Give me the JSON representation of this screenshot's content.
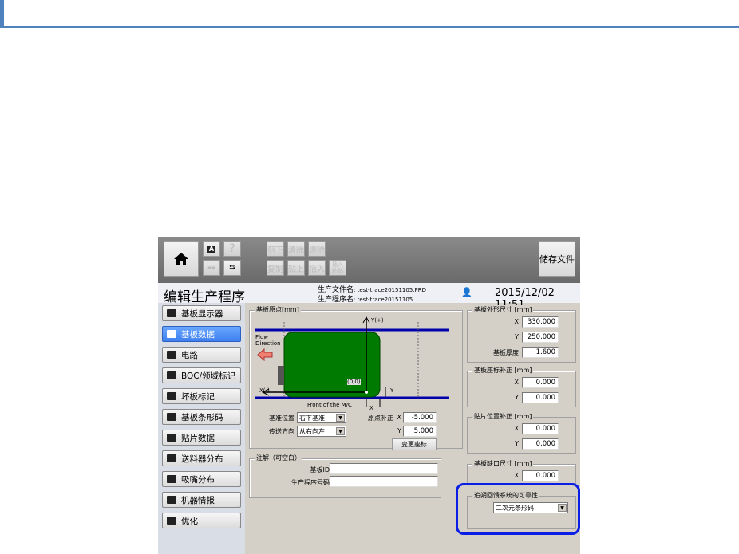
{
  "toolbar": {
    "home": "home",
    "buttons_row1": [
      "剪下",
      "清除",
      "删除"
    ],
    "buttons_row2": [
      "复制",
      "贴上",
      "插入"
    ],
    "insert_paste": [
      "插入",
      "粘贴"
    ],
    "save": "储存文件",
    "help": "?",
    "a_label": "A"
  },
  "header": {
    "title": "编辑生产程序",
    "file_label": "生产文件名",
    "file_value": ": test-trace20151105.PRD",
    "program_label": "生产程序名",
    "program_value": ": test-trace20151105",
    "datetime": "2015/12/02 11:51"
  },
  "sidebar": {
    "items": [
      {
        "label": "基板显示器"
      },
      {
        "label": "基板数据",
        "active": true
      },
      {
        "label": "电路"
      },
      {
        "label": "BOC/领域标记"
      },
      {
        "label": "坏板标记"
      },
      {
        "label": "基板条形码"
      },
      {
        "label": "贴片数据"
      },
      {
        "label": "送料器分布"
      },
      {
        "label": "吸嘴分布"
      },
      {
        "label": "机器情报"
      },
      {
        "label": "优化"
      }
    ]
  },
  "origin": {
    "legend": "基板原点[mm]",
    "flow": "Flow",
    "direction": "Direction",
    "yplus": "Y(+)",
    "xminus": "X(-)",
    "origin_label": "(0,0)",
    "front": "Front of the M/C",
    "x": "X",
    "y": "Y",
    "ref_label": "基准位置",
    "ref_value": "右下基准",
    "conv_label": "传送方向",
    "conv_value": "从右向左",
    "offset_label": "原点补正",
    "offset_x": "-5.000",
    "offset_y": "5.000",
    "change_button": "变更座标"
  },
  "notes": {
    "legend": "注解（可空白）",
    "board_id_label": "基板ID",
    "board_id": "",
    "prog_no_label": "生产程序号码",
    "prog_no": ""
  },
  "size": {
    "legend": "基板外形尺寸 [mm]",
    "x_label": "X",
    "x": "330.000",
    "y_label": "Y",
    "y": "250.000",
    "thick_label": "基板厚度",
    "thick": "1.600"
  },
  "coord": {
    "legend": "基板座标补正 [mm]",
    "x_label": "X",
    "x": "0.000",
    "y_label": "Y",
    "y": "0.000"
  },
  "mount": {
    "legend": "贴片位置补正 [mm]",
    "x_label": "X",
    "x": "0.000",
    "y_label": "Y",
    "y": "0.000"
  },
  "notch": {
    "legend": "基板缺口尺寸 [mm]",
    "x_label": "X",
    "x": "0.000"
  },
  "trace": {
    "legend": "追朔回馈系统的可靠性",
    "value": "二次元条形码",
    "highlight": "#0a1ee6"
  },
  "colors": {
    "board": "#007a00",
    "rail": "#0000aa",
    "active": "#3d7ff0",
    "accent": "#4f81bd"
  }
}
